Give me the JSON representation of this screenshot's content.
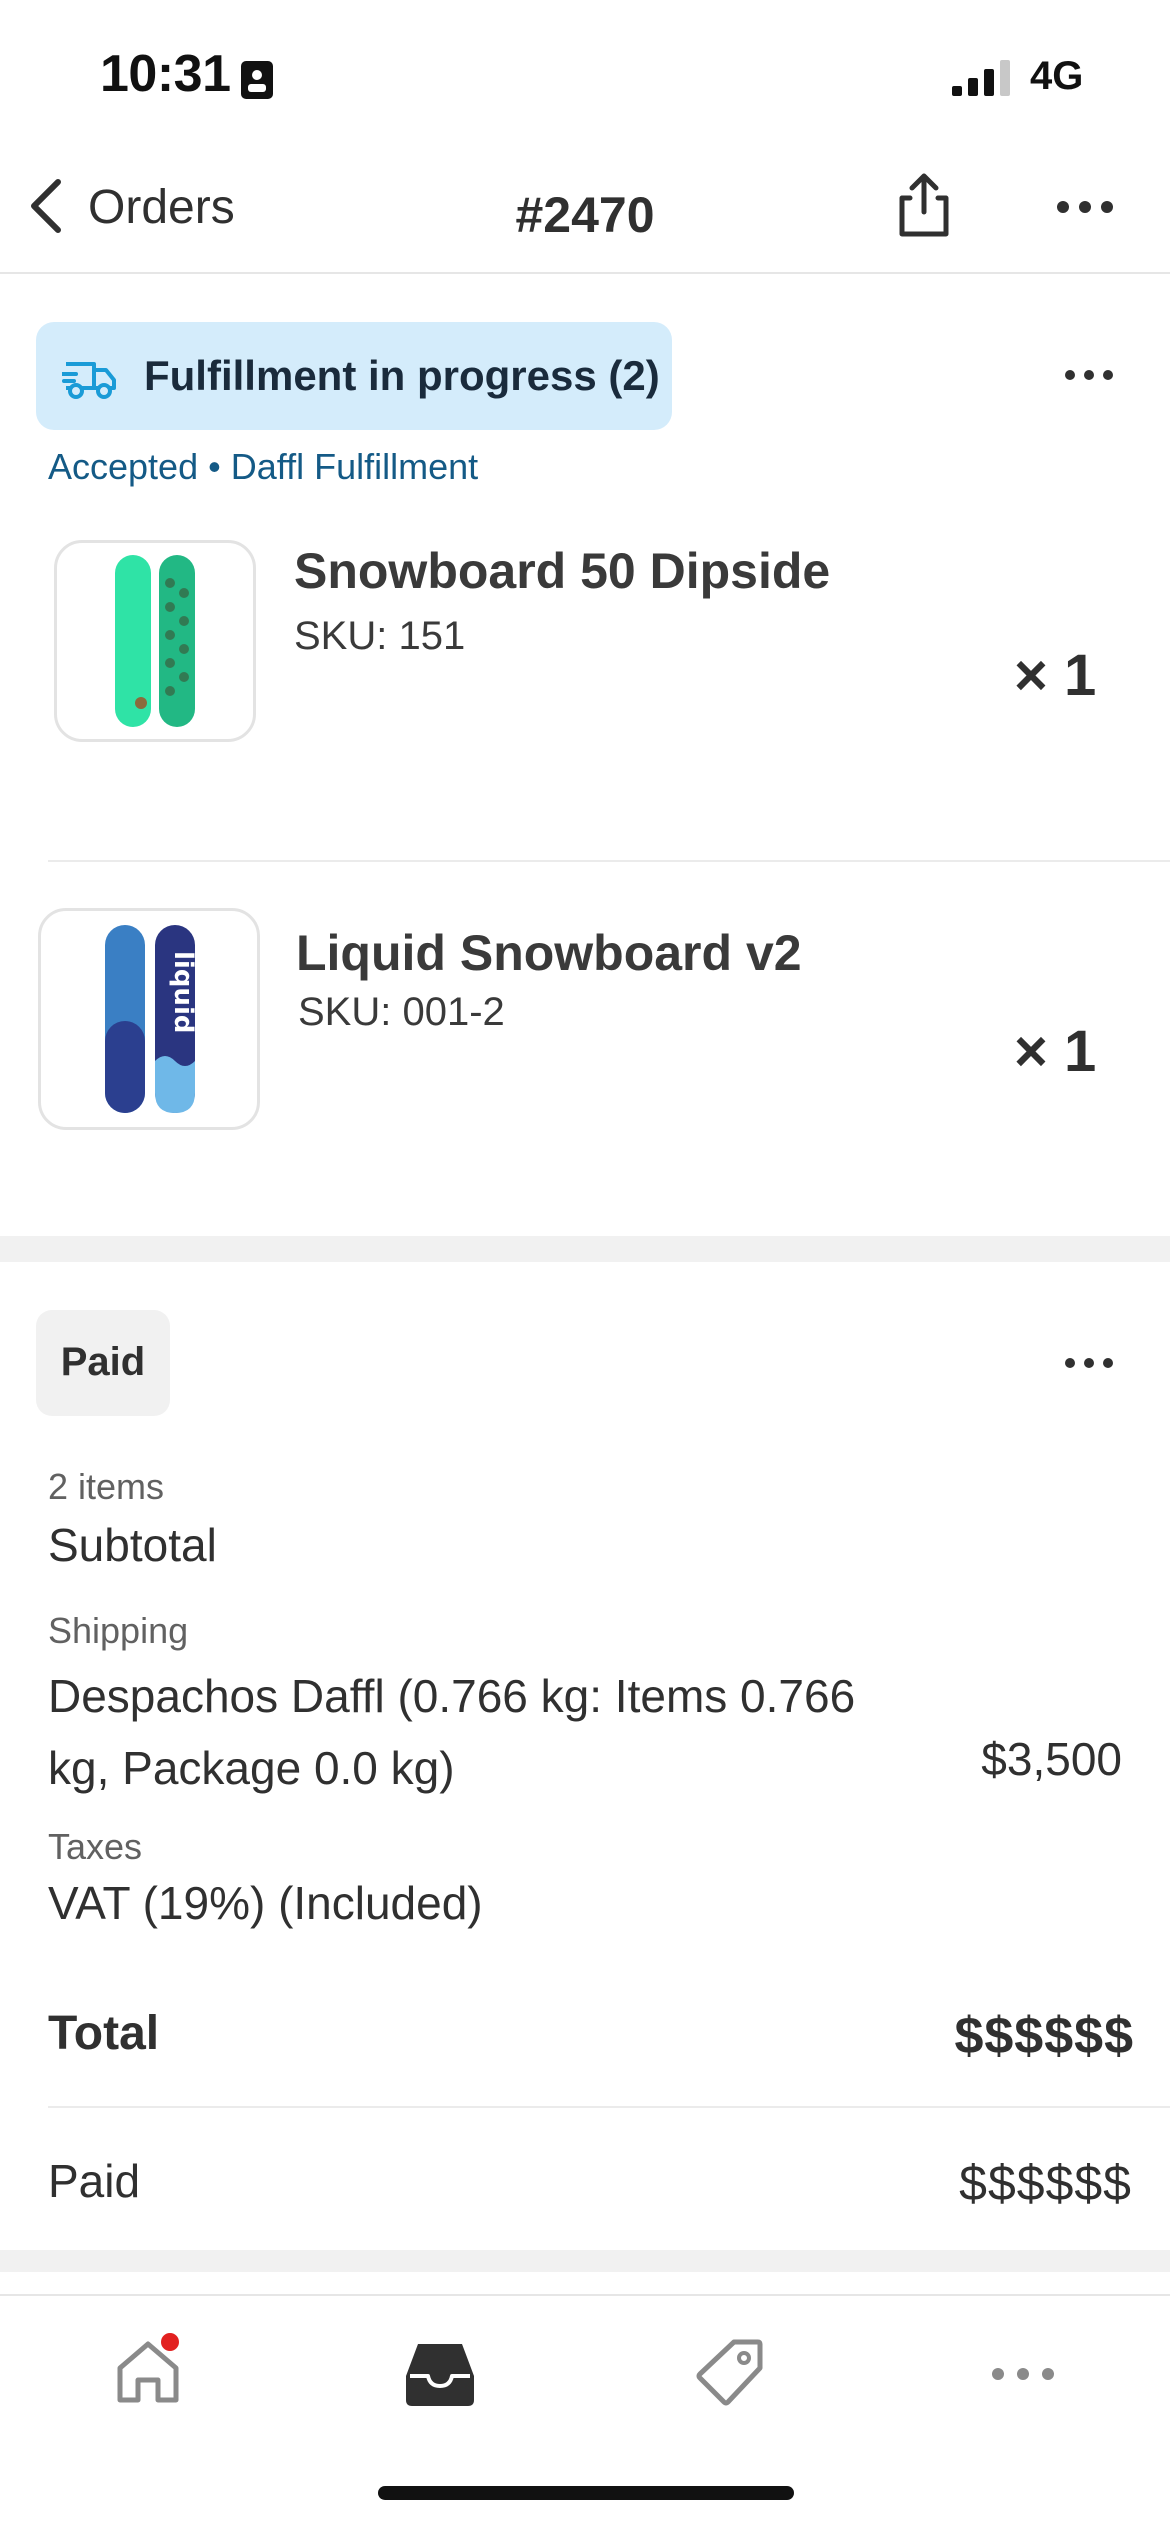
{
  "status_bar": {
    "time": "10:31",
    "network": "4G"
  },
  "nav": {
    "back_label": "Orders",
    "title": "#2470"
  },
  "fulfillment": {
    "badge_label": "Fulfillment in progress (2)",
    "subtitle": "Accepted • Daffl Fulfillment",
    "badge_color": "#d4ecfb",
    "items": [
      {
        "name": "Snowboard 50 Dipside",
        "sku": "SKU: 151",
        "qty": "× 1"
      },
      {
        "name": "Liquid Snowboard v2",
        "sku": "SKU: 001-2",
        "qty": "× 1"
      }
    ]
  },
  "payment": {
    "status_badge": "Paid",
    "items_count": "2 items",
    "subtotal_label": "Subtotal",
    "shipping_label": "Shipping",
    "shipping_method": "Despachos Daffl (0.766 kg: Items 0.766 kg, Package 0.0 kg)",
    "shipping_amount": "$3,500",
    "taxes_label": "Taxes",
    "tax_line": "VAT (19%) (Included)",
    "total_label": "Total",
    "total_amount": "$$$$$$",
    "paid_label": "Paid",
    "paid_amount": "$$$$$$"
  },
  "tabbar": {
    "tabs": [
      "home-icon",
      "orders-inbox-icon",
      "products-tag-icon",
      "more-icon"
    ],
    "notification_color": "#e22120"
  }
}
